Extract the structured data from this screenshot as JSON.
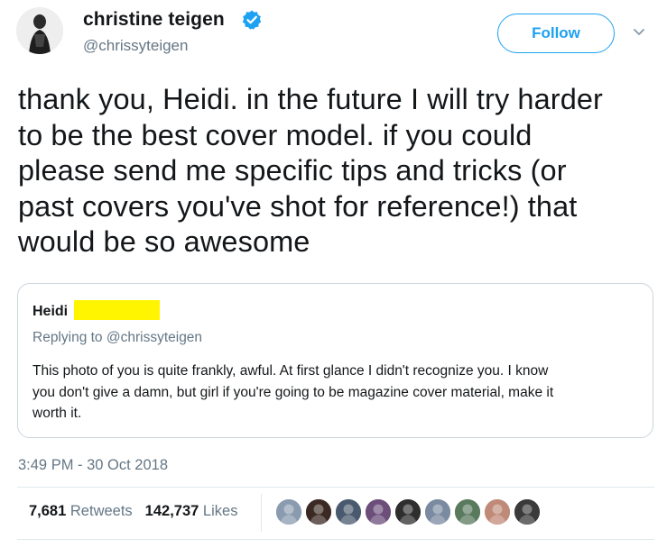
{
  "author": {
    "name": "christine teigen",
    "handle": "@chrissyteigen",
    "avatar_icon": "profile-photo-icon",
    "verified_icon": "verified-badge-icon"
  },
  "actions": {
    "follow_label": "Follow",
    "menu_icon": "chevron-down-icon"
  },
  "tweet": {
    "text_lines": [
      "thank you, Heidi. in the future I will try harder",
      "to be the best cover model. if you could",
      "please send me specific tips and tricks (or",
      "past covers you've shot for reference!) that",
      "would be so awesome"
    ],
    "timestamp": "3:49 PM - 30 Oct 2018"
  },
  "quoted_tweet": {
    "name": "Heidi",
    "replying_to_prefix": "Replying to ",
    "replying_to_handle": "@chrissyteigen",
    "text_lines": [
      "This photo of you is quite frankly, awful. At first glance I didn't recognize you. I know",
      "you don't give a damn, but girl if you're going to be magazine cover material, make it",
      "worth it."
    ]
  },
  "stats": {
    "retweets_count": "7,681",
    "retweets_label": "Retweets",
    "likes_count": "142,737",
    "likes_label": "Likes"
  },
  "liker_avatars": [
    {
      "icon": "liker-avatar-1",
      "color": "#8a9bb0"
    },
    {
      "icon": "liker-avatar-2",
      "color": "#3b2a24"
    },
    {
      "icon": "liker-avatar-3",
      "color": "#4a5a6e"
    },
    {
      "icon": "liker-avatar-4",
      "color": "#6b4e7a"
    },
    {
      "icon": "liker-avatar-5",
      "color": "#2e2e2e"
    },
    {
      "icon": "liker-avatar-6",
      "color": "#7a8aa0"
    },
    {
      "icon": "liker-avatar-7",
      "color": "#5a7a5e"
    },
    {
      "icon": "liker-avatar-8",
      "color": "#c08a78"
    },
    {
      "icon": "liker-avatar-9",
      "color": "#3a3a3a"
    }
  ],
  "colors": {
    "accent": "#1da1f2",
    "secondary_text": "#657786",
    "primary_text": "#14171a",
    "redaction": "#fff500"
  }
}
